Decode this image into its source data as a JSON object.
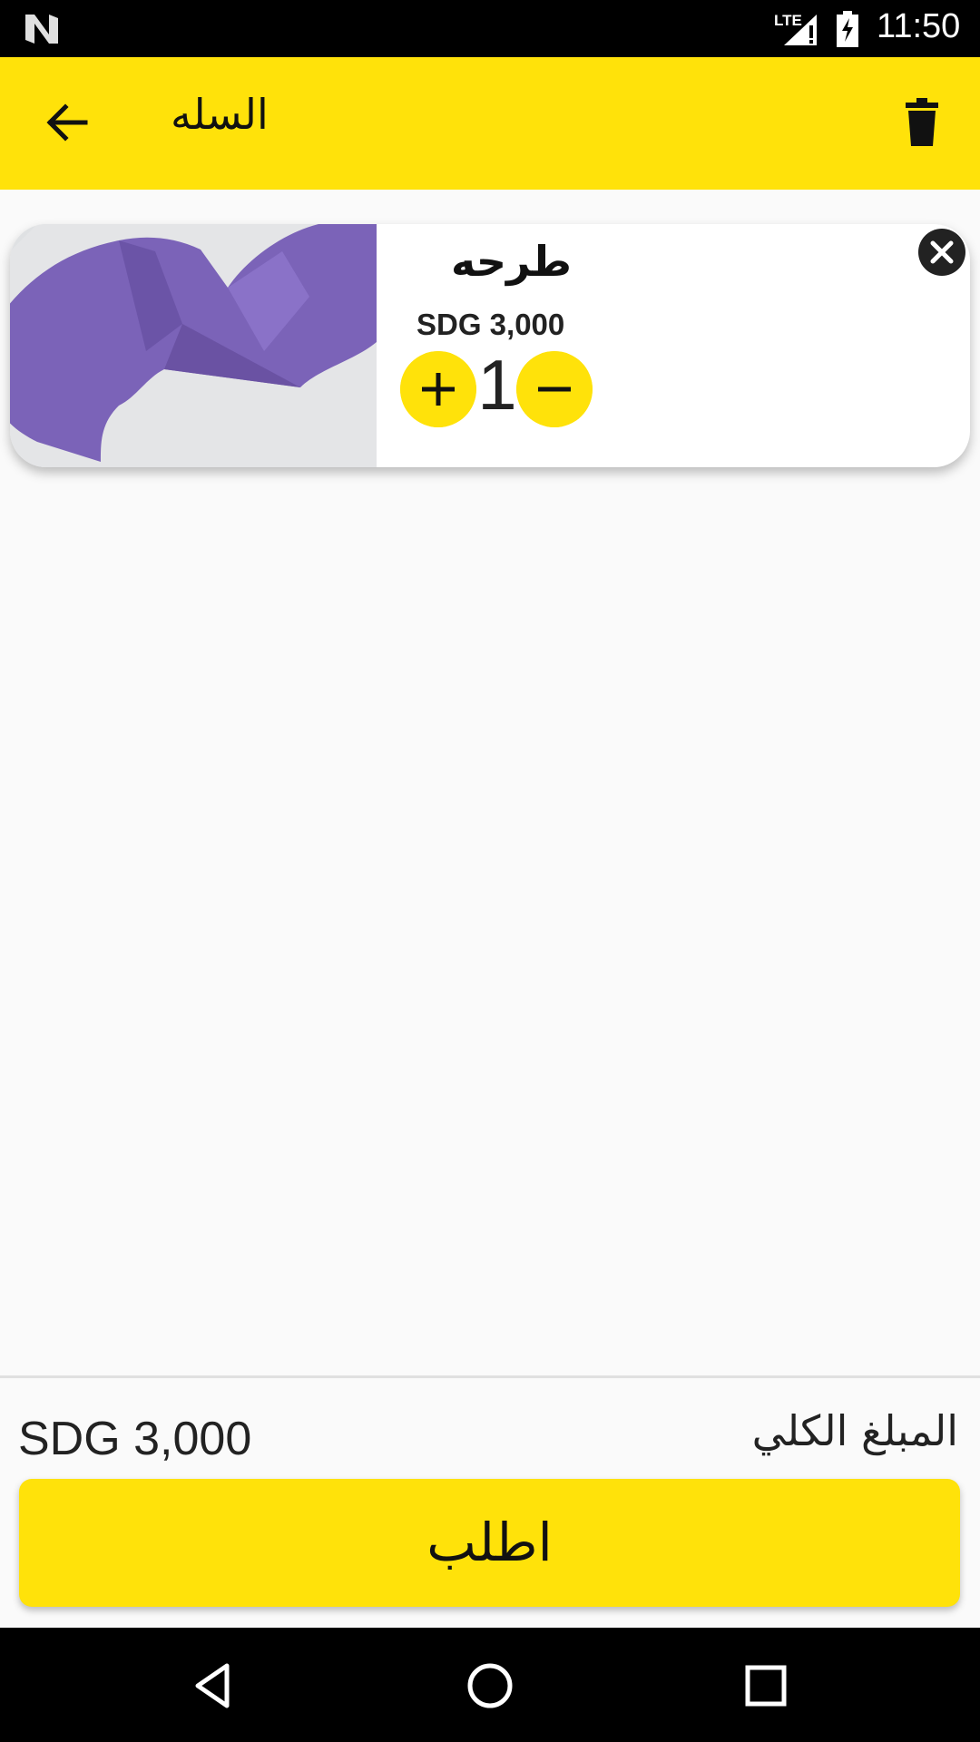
{
  "status_bar": {
    "time": "11:50",
    "network": "LTE"
  },
  "app_bar": {
    "title": "السله"
  },
  "cart": {
    "items": [
      {
        "name": "طرحه",
        "price": "SDG 3,000",
        "quantity": "1",
        "image": "purple-scarf"
      }
    ]
  },
  "summary": {
    "total_label": "المبلغ الكلي",
    "total_amount": "SDG 3,000"
  },
  "order_button": {
    "label": "اطلب"
  },
  "colors": {
    "accent": "#ffe20a",
    "background": "#fafafa",
    "text": "#222222"
  }
}
